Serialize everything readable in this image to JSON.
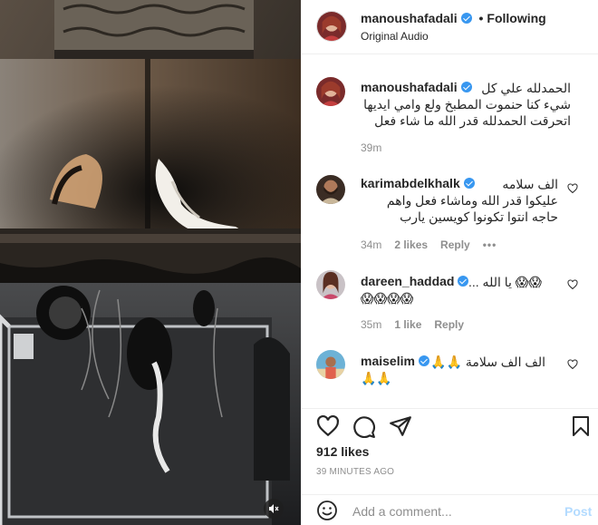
{
  "header": {
    "username": "manoushafadali",
    "separator": "•",
    "follow_status": "Following",
    "subtitle": "Original Audio"
  },
  "caption": {
    "username": "manoushafadali",
    "text_lines": [
      "الحمدلله علي كل",
      "شيء كنا حنموت المطبخ ولع وامي ايديها",
      "اتحرقت الحمدلله قدر الله ما شاء فعل"
    ],
    "time": "39m"
  },
  "comments": [
    {
      "username": "karimabdelkhalk",
      "text_lines": [
        "الف سلامه",
        "عليكوا قدر الله وماشاء فعل واهم",
        "حاجه انتوا تكونوا كويسين يارب"
      ],
      "time": "34m",
      "likes": "2 likes",
      "reply": "Reply",
      "more": "•••"
    },
    {
      "username": "dareen_haddad",
      "text_lines": [
        "😱😱 يا الله ...",
        "😱😱😱😱"
      ],
      "time": "35m",
      "likes": "1 like",
      "reply": "Reply"
    },
    {
      "username": "maiselim",
      "text_lines": [
        "الف الف سلامة 🙏🙏",
        "🙏🙏"
      ]
    }
  ],
  "actions": {
    "likes": "912 likes",
    "time_ago": "39 MINUTES AGO"
  },
  "add_comment": {
    "placeholder": "Add a comment...",
    "post_label": "Post"
  },
  "icons": {
    "verified": "verified-badge-icon",
    "like": "heart-icon",
    "comment": "comment-bubble-icon",
    "share": "paper-plane-icon",
    "save": "bookmark-icon",
    "emoji": "smiley-icon",
    "audio": "speaker-muted-icon"
  },
  "colors": {
    "verified": "#3897f0",
    "post_disabled": "#b3dbff",
    "muted_text": "#8e8e8e"
  }
}
